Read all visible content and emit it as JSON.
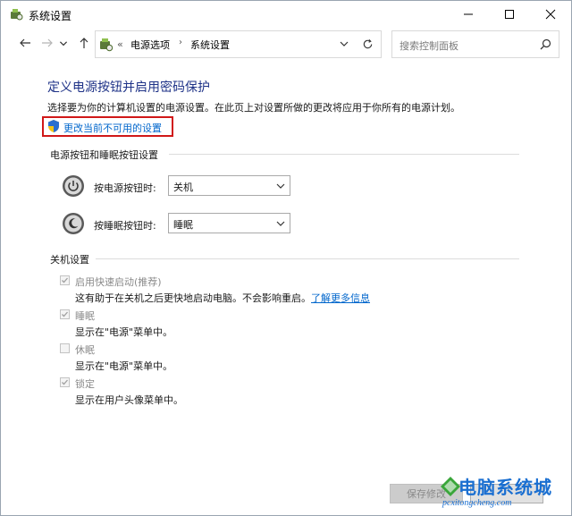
{
  "window": {
    "title": "系统设置",
    "icon": "power-options-icon"
  },
  "nav": {
    "back_icon": "arrow-left-icon",
    "forward_icon": "arrow-right-icon",
    "up_icon": "arrow-up-icon",
    "address": {
      "prefix": "«",
      "items": [
        "电源选项",
        "系统设置"
      ]
    },
    "search_placeholder": "搜索控制面板"
  },
  "main": {
    "heading": "定义电源按钮并启用密码保护",
    "description": "选择要为你的计算机设置的电源设置。在此页上对设置所做的更改将应用于你所有的电源计划。",
    "change_link": "更改当前不可用的设置",
    "highlight_color": "#d01818"
  },
  "power_buttons": {
    "section_title": "电源按钮和睡眠按钮设置",
    "power_label": "按电源按钮时:",
    "power_value": "关机",
    "sleep_label": "按睡眠按钮时:",
    "sleep_value": "睡眠"
  },
  "shutdown": {
    "section_title": "关机设置",
    "options": [
      {
        "label": "启用快速启动(推荐)",
        "desc": "这有助于在关机之后更快地启动电脑。不会影响重启。",
        "link": "了解更多信息",
        "checked": true
      },
      {
        "label": "睡眠",
        "desc": "显示在\"电源\"菜单中。",
        "checked": true
      },
      {
        "label": "休眠",
        "desc": "显示在\"电源\"菜单中。",
        "checked": false
      },
      {
        "label": "锁定",
        "desc": "显示在用户头像菜单中。",
        "checked": true
      }
    ]
  },
  "footer": {
    "save_label": "保存修改"
  },
  "watermark": {
    "title": "电脑系统城",
    "url": "pcxitongcheng.com"
  }
}
